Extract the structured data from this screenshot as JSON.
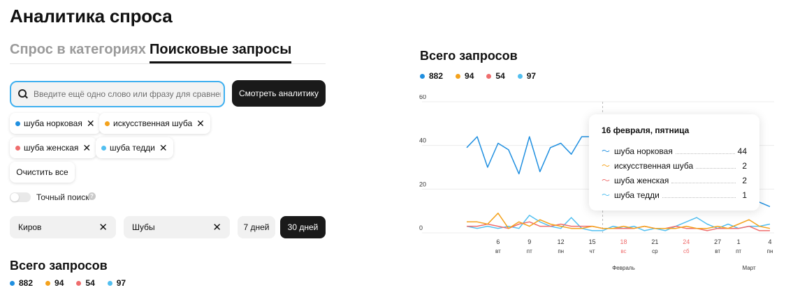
{
  "header": {
    "title": "Аналитика спроса"
  },
  "tabs": [
    {
      "label": "Спрос в категориях",
      "active": false
    },
    {
      "label": "Поисковые запросы",
      "active": true
    }
  ],
  "search": {
    "placeholder": "Введите ещё одно слово или фразу для сравнения",
    "button": "Смотреть аналитику"
  },
  "chips": [
    {
      "label": "шуба норковая",
      "color": "#1f8fe0"
    },
    {
      "label": "искусственная шуба",
      "color": "#f4a21c"
    },
    {
      "label": "шуба женская",
      "color": "#ef6d6d"
    },
    {
      "label": "шуба тедди",
      "color": "#52bff0"
    }
  ],
  "clear_all": "Очистить все",
  "exact_search": {
    "label": "Точный поиск",
    "enabled": false,
    "help_glyph": "?"
  },
  "filters": {
    "region": "Киров",
    "category": "Шубы"
  },
  "periods": {
    "week": "7 дней",
    "month": "30 дней",
    "selected": "30 дней"
  },
  "totals": {
    "title": "Всего запросов",
    "items": [
      {
        "value": "882",
        "color": "#1f8fe0"
      },
      {
        "value": "94",
        "color": "#f4a21c"
      },
      {
        "value": "54",
        "color": "#ef6d6d"
      },
      {
        "value": "97",
        "color": "#52bff0"
      }
    ]
  },
  "tooltip": {
    "title": "16 февраля, пятница",
    "rows": [
      {
        "name": "шуба норковая",
        "value": "44",
        "color": "#1f8fe0"
      },
      {
        "name": "искусственная шуба",
        "value": "2",
        "color": "#f4a21c"
      },
      {
        "name": "шуба женская",
        "value": "2",
        "color": "#ef6d6d"
      },
      {
        "name": "шуба тедди",
        "value": "1",
        "color": "#52bff0"
      }
    ]
  },
  "chart_data": {
    "type": "line",
    "ylim": [
      0,
      60
    ],
    "y_ticks": [
      0,
      20,
      40,
      60
    ],
    "grid": true,
    "x_ticks": [
      {
        "day": "6",
        "weekday": "вт",
        "weekend": false,
        "index": 3
      },
      {
        "day": "9",
        "weekday": "пт",
        "weekend": false,
        "index": 6
      },
      {
        "day": "12",
        "weekday": "пн",
        "weekend": false,
        "index": 9
      },
      {
        "day": "15",
        "weekday": "чт",
        "weekend": false,
        "index": 12
      },
      {
        "day": "18",
        "weekday": "вс",
        "weekend": true,
        "index": 15
      },
      {
        "day": "21",
        "weekday": "ср",
        "weekend": false,
        "index": 18
      },
      {
        "day": "24",
        "weekday": "сб",
        "weekend": true,
        "index": 21
      },
      {
        "day": "27",
        "weekday": "вт",
        "weekend": false,
        "index": 24
      },
      {
        "day": "1",
        "weekday": "пт",
        "weekend": false,
        "index": 26
      },
      {
        "day": "4",
        "weekday": "пн",
        "weekend": false,
        "index": 29
      }
    ],
    "months": [
      {
        "label": "Февраль",
        "index": 15
      },
      {
        "label": "Март",
        "index": 27
      }
    ],
    "highlight_index": 13,
    "series": [
      {
        "name": "шуба норковая",
        "color": "#1f8fe0",
        "values": [
          39,
          44,
          30,
          41,
          38,
          27,
          44,
          28,
          39,
          41,
          36,
          44,
          44,
          44,
          44,
          44,
          44,
          44,
          44,
          44,
          44,
          44,
          44,
          44,
          44,
          44,
          20,
          18,
          14,
          12
        ]
      },
      {
        "name": "искусственная шуба",
        "color": "#f4a21c",
        "values": [
          5,
          5,
          4,
          9,
          2,
          5,
          3,
          6,
          4,
          3,
          2,
          2,
          3,
          2,
          2,
          3,
          2,
          3,
          2,
          2,
          2,
          3,
          2,
          2,
          3,
          2,
          4,
          6,
          3,
          2
        ]
      },
      {
        "name": "шуба женская",
        "color": "#ef6d6d",
        "values": [
          3,
          3,
          4,
          3,
          2,
          4,
          5,
          3,
          3,
          4,
          3,
          3,
          3,
          2,
          2,
          2,
          2,
          3,
          2,
          2,
          3,
          2,
          2,
          1,
          2,
          2,
          2,
          3,
          1,
          1
        ]
      },
      {
        "name": "шуба тедди",
        "color": "#52bff0",
        "values": [
          3,
          2,
          3,
          2,
          3,
          2,
          8,
          5,
          3,
          2,
          7,
          2,
          1,
          1,
          3,
          2,
          3,
          1,
          2,
          1,
          3,
          5,
          7,
          4,
          2,
          4,
          2,
          3,
          3,
          4
        ]
      }
    ]
  }
}
